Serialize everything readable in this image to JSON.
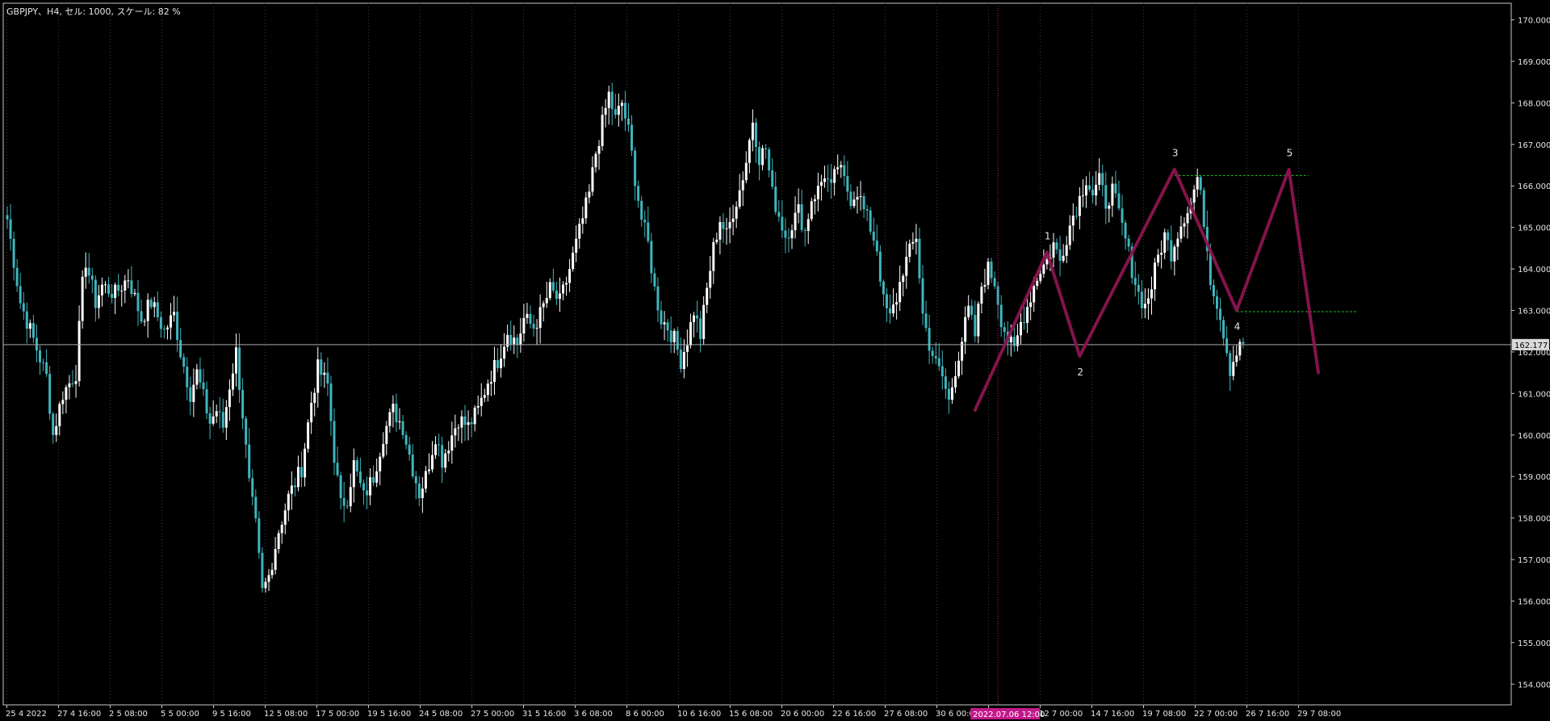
{
  "header": {
    "info": "GBPJPY、H4, セル: 1000, スケール: 82 %"
  },
  "colors": {
    "background": "#000000",
    "frame": "#c8c8c8",
    "candle_up": "#ffffff",
    "candle_down": "#3fb5bd",
    "grid": "#3a3a3a",
    "bid_line": "#a8a8a8",
    "wave_line": "#8b1450",
    "level_line": "#1fbf1f",
    "crosshair": "#c2188a",
    "time_tag": "#c2188a"
  },
  "chart_data": {
    "type": "candlestick",
    "symbol": "GBPJPY",
    "timeframe": "H4",
    "ylim": [
      153.5,
      170.4
    ],
    "y_ticks": [
      "170.000",
      "169.000",
      "168.000",
      "167.000",
      "166.000",
      "165.000",
      "164.000",
      "163.000",
      "162.000",
      "161.000",
      "160.000",
      "159.000",
      "158.000",
      "157.000",
      "156.000",
      "155.000",
      "154.000"
    ],
    "x_labels": [
      "25 4 2022",
      "27 4 16:00",
      "2 5 08:00",
      "5 5 00:00",
      "9 5 16:00",
      "12 5 08:00",
      "17 5 00:00",
      "19 5 16:00",
      "24 5 08:00",
      "27 5 00:00",
      "31 5 16:00",
      "3 6 08:00",
      "8 6 00:00",
      "10 6 16:00",
      "15 6 08:00",
      "20 6 00:00",
      "22 6 16:00",
      "27 6 08:00",
      "30 6 00:00",
      "2022.07.06 12:00",
      "12 7 00:00",
      "14 7 16:00",
      "19 7 08:00",
      "22 7 00:00",
      "26 7 16:00",
      "29 7 08:00"
    ],
    "current_price": "162.177",
    "crosshair_time": "2022.07.06 12:00",
    "price_path": [
      [
        0,
        165.2
      ],
      [
        4,
        163.2
      ],
      [
        8,
        162.3
      ],
      [
        12,
        161.4
      ],
      [
        14,
        160.0
      ],
      [
        17,
        161.0
      ],
      [
        21,
        161.5
      ],
      [
        23,
        163.6
      ],
      [
        24,
        164.2
      ],
      [
        27,
        163.2
      ],
      [
        29,
        163.6
      ],
      [
        33,
        163.4
      ],
      [
        37,
        163.8
      ],
      [
        41,
        162.8
      ],
      [
        44,
        163.2
      ],
      [
        48,
        162.5
      ],
      [
        51,
        162.9
      ],
      [
        53,
        162.0
      ],
      [
        56,
        161.0
      ],
      [
        58,
        161.5
      ],
      [
        60,
        160.9
      ],
      [
        62,
        160.3
      ],
      [
        64,
        160.6
      ],
      [
        66,
        160.2
      ],
      [
        68,
        161.2
      ],
      [
        70,
        162.0
      ],
      [
        72,
        160.5
      ],
      [
        74,
        158.8
      ],
      [
        76,
        157.8
      ],
      [
        78,
        156.2
      ],
      [
        80,
        156.6
      ],
      [
        83,
        157.7
      ],
      [
        86,
        158.5
      ],
      [
        90,
        159.2
      ],
      [
        93,
        160.8
      ],
      [
        95,
        161.6
      ],
      [
        98,
        161.2
      ],
      [
        100,
        159.5
      ],
      [
        102,
        158.3
      ],
      [
        104,
        158.5
      ],
      [
        106,
        159.3
      ],
      [
        109,
        158.5
      ],
      [
        112,
        159.0
      ],
      [
        115,
        160.0
      ],
      [
        118,
        160.6
      ],
      [
        121,
        160.2
      ],
      [
        124,
        159.2
      ],
      [
        126,
        158.6
      ],
      [
        128,
        159.0
      ],
      [
        131,
        160.0
      ],
      [
        133,
        159.4
      ],
      [
        135,
        159.8
      ],
      [
        138,
        160.4
      ],
      [
        141,
        160.2
      ],
      [
        144,
        160.6
      ],
      [
        147,
        161.3
      ],
      [
        150,
        161.8
      ],
      [
        153,
        162.5
      ],
      [
        156,
        162.2
      ],
      [
        158,
        162.8
      ],
      [
        161,
        162.6
      ],
      [
        163,
        162.9
      ],
      [
        166,
        163.5
      ],
      [
        169,
        163.2
      ],
      [
        171,
        163.7
      ],
      [
        173,
        164.3
      ],
      [
        176,
        165.2
      ],
      [
        178,
        165.8
      ],
      [
        180,
        166.8
      ],
      [
        182,
        167.5
      ],
      [
        184,
        168.2
      ],
      [
        186,
        167.6
      ],
      [
        188,
        168.0
      ],
      [
        190,
        167.3
      ],
      [
        192,
        166.2
      ],
      [
        194,
        165.2
      ],
      [
        196,
        164.6
      ],
      [
        198,
        163.5
      ],
      [
        200,
        162.8
      ],
      [
        202,
        162.6
      ],
      [
        204,
        162.3
      ],
      [
        206,
        161.8
      ],
      [
        208,
        162.3
      ],
      [
        210,
        163.0
      ],
      [
        212,
        162.4
      ],
      [
        214,
        163.5
      ],
      [
        216,
        164.5
      ],
      [
        218,
        165.2
      ],
      [
        220,
        164.8
      ],
      [
        222,
        165.4
      ],
      [
        224,
        165.9
      ],
      [
        226,
        166.6
      ],
      [
        228,
        167.6
      ],
      [
        230,
        166.7
      ],
      [
        232,
        166.9
      ],
      [
        234,
        165.8
      ],
      [
        236,
        165.3
      ],
      [
        238,
        164.8
      ],
      [
        240,
        165.1
      ],
      [
        242,
        165.4
      ],
      [
        244,
        164.9
      ],
      [
        246,
        165.7
      ],
      [
        248,
        165.9
      ],
      [
        250,
        166.3
      ],
      [
        252,
        165.9
      ],
      [
        254,
        166.5
      ],
      [
        256,
        166.1
      ],
      [
        258,
        165.7
      ],
      [
        260,
        165.9
      ],
      [
        262,
        165.4
      ],
      [
        264,
        165.0
      ],
      [
        266,
        164.5
      ],
      [
        268,
        163.2
      ],
      [
        270,
        162.8
      ],
      [
        272,
        163.3
      ],
      [
        274,
        164.0
      ],
      [
        276,
        164.4
      ],
      [
        278,
        164.8
      ],
      [
        280,
        162.9
      ],
      [
        282,
        162.2
      ],
      [
        284,
        161.7
      ],
      [
        286,
        161.4
      ],
      [
        288,
        160.8
      ],
      [
        290,
        161.6
      ],
      [
        292,
        162.3
      ],
      [
        294,
        163.0
      ],
      [
        296,
        162.4
      ],
      [
        298,
        163.6
      ],
      [
        300,
        164.0
      ],
      [
        302,
        163.7
      ],
      [
        304,
        162.8
      ],
      [
        306,
        162.3
      ],
      [
        308,
        162.0
      ],
      [
        310,
        162.7
      ],
      [
        312,
        163.1
      ],
      [
        314,
        163.6
      ],
      [
        316,
        164.0
      ],
      [
        318,
        164.2
      ],
      [
        320,
        164.6
      ],
      [
        322,
        164.2
      ],
      [
        324,
        164.8
      ],
      [
        326,
        165.3
      ],
      [
        328,
        165.7
      ],
      [
        330,
        166.2
      ],
      [
        332,
        165.8
      ],
      [
        334,
        166.1
      ],
      [
        336,
        165.6
      ],
      [
        338,
        165.9
      ],
      [
        340,
        165.3
      ],
      [
        342,
        164.7
      ],
      [
        344,
        164.0
      ],
      [
        346,
        163.4
      ],
      [
        348,
        163.1
      ],
      [
        350,
        163.6
      ],
      [
        352,
        164.3
      ],
      [
        354,
        164.8
      ],
      [
        356,
        164.4
      ],
      [
        358,
        164.9
      ],
      [
        360,
        165.3
      ],
      [
        362,
        165.6
      ],
      [
        364,
        166.2
      ],
      [
        366,
        165.2
      ],
      [
        368,
        163.8
      ],
      [
        370,
        163.2
      ],
      [
        372,
        162.5
      ],
      [
        374,
        161.6
      ],
      [
        376,
        162.0
      ],
      [
        378,
        162.2
      ]
    ],
    "bid_price": 162.177,
    "wave_points": [
      {
        "label": "",
        "x": 296,
        "y": 160.6
      },
      {
        "label": "1",
        "x": 318,
        "y": 164.4
      },
      {
        "label": "2",
        "x": 328,
        "y": 161.9
      },
      {
        "label": "3",
        "x": 357,
        "y": 166.4
      },
      {
        "label": "4",
        "x": 376,
        "y": 163.0
      },
      {
        "label": "5",
        "x": 392,
        "y": 166.4
      },
      {
        "label": "",
        "x": 401,
        "y": 161.5
      }
    ],
    "levels": [
      {
        "y": 166.25,
        "x1": 357,
        "x2": 398
      },
      {
        "y": 162.97,
        "x1": 376,
        "x2": 413
      }
    ],
    "crosshair_x": 303
  }
}
